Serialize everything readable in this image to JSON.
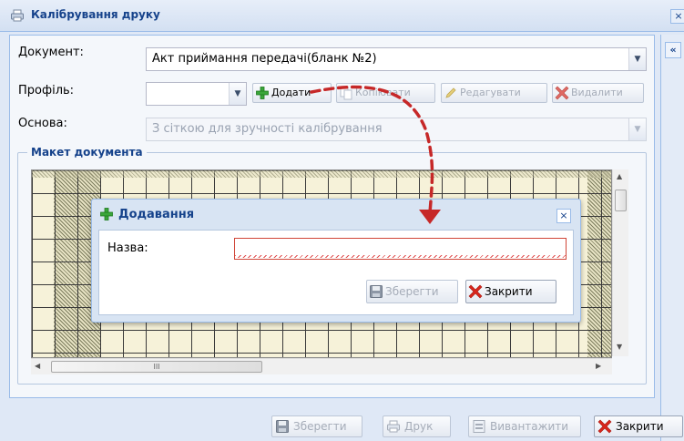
{
  "window": {
    "title": "Калібрування друку",
    "close_symbol": "×",
    "collapse_symbol": "«"
  },
  "form": {
    "document_label": "Документ:",
    "document_value": "Акт приймання передачі(бланк №2)",
    "profile_label": "Профіль:",
    "profile_value": "",
    "base_label": "Основа:",
    "base_value": "З сіткою для зручності калібрування"
  },
  "toolbar": {
    "add_label": "Додати",
    "copy_label": "Копіювати",
    "edit_label": "Редагувати",
    "delete_label": "Видалити"
  },
  "layout_section": {
    "title": "Макет документа",
    "hscroll_grip": "III"
  },
  "dialog": {
    "title": "Додавання",
    "name_label": "Назва:",
    "name_value": "",
    "save_label": "Зберегти",
    "close_label": "Закрити"
  },
  "footer": {
    "save_label": "Зберегти",
    "print_label": "Друк",
    "export_label": "Вивантажити",
    "close_label": "Закрити"
  },
  "icons": {
    "window": "printer-icon",
    "add": "plus-icon",
    "copy": "copy-icon",
    "edit": "pencil-icon",
    "delete": "red-x-icon",
    "save": "floppy-icon",
    "print": "printer-icon",
    "export": "export-icon",
    "close": "red-x-icon"
  },
  "colors": {
    "title_text": "#15428b",
    "panel_border": "#99bbe8",
    "invalid_field": "#d04437",
    "hint_arrow": "#c62828",
    "add_icon": "#2e9b2e",
    "delete_icon": "#d9261c"
  }
}
